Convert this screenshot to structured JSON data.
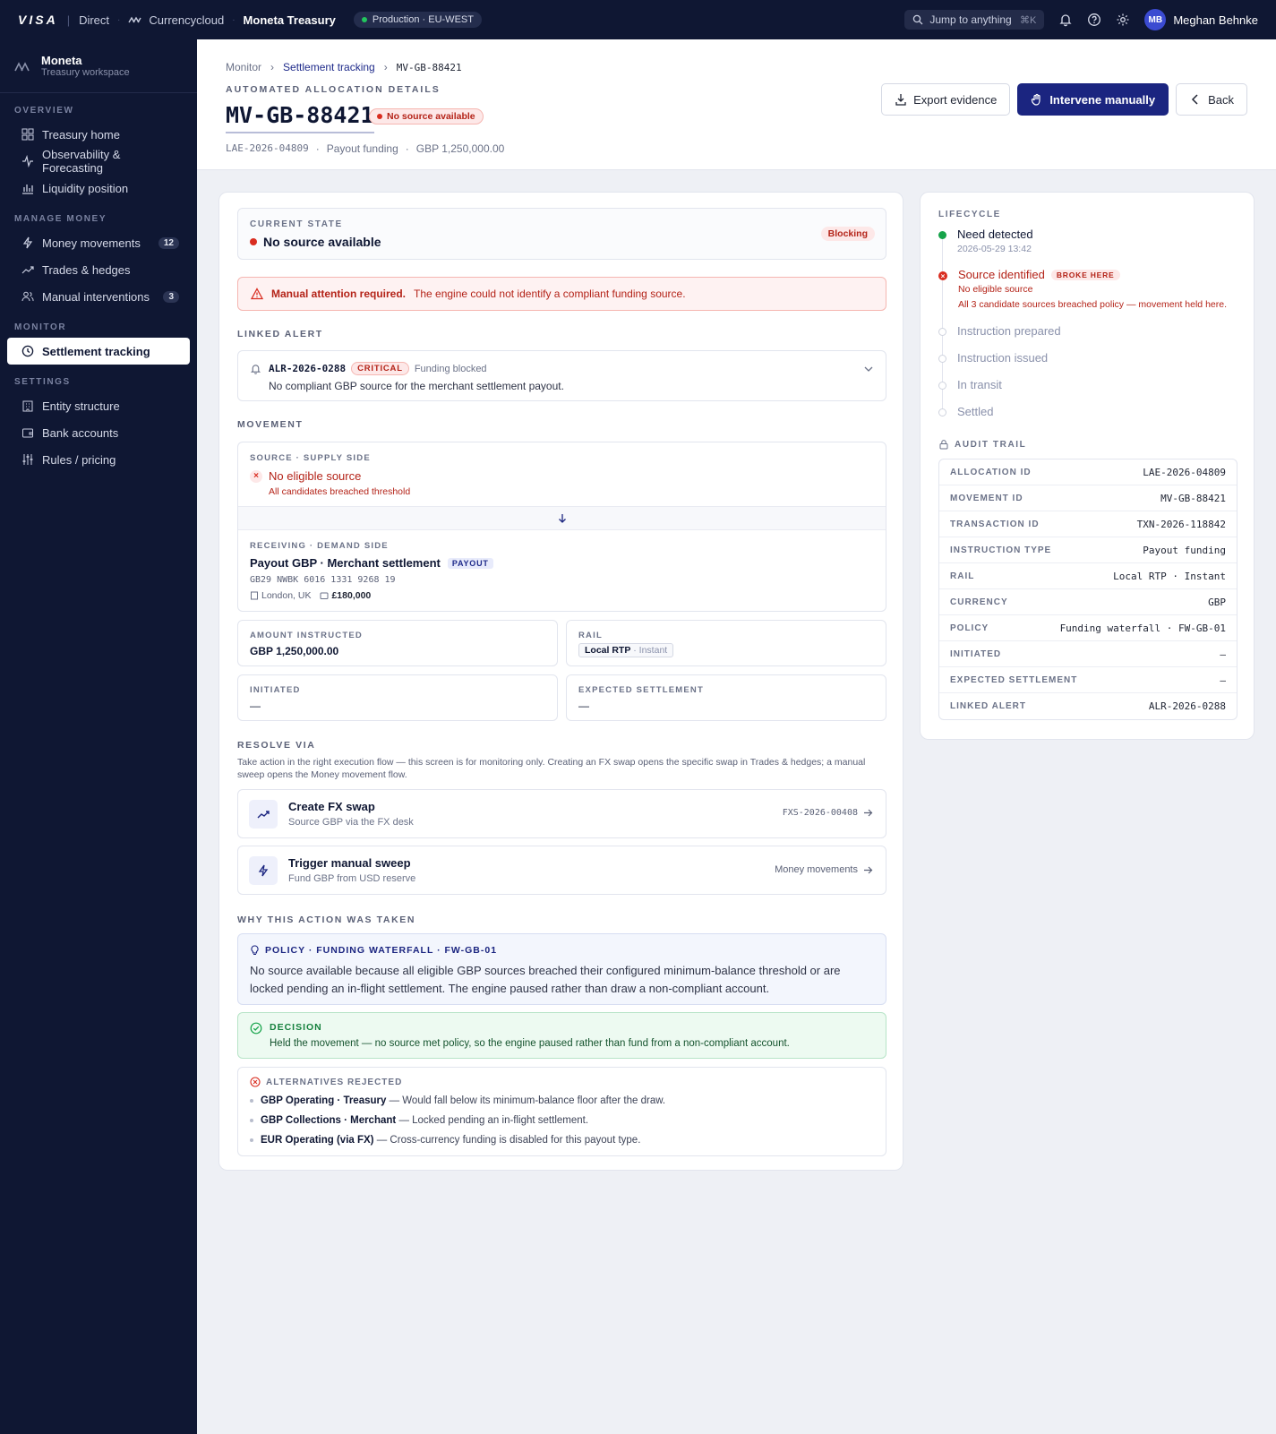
{
  "topbar": {
    "brand": "VISA",
    "product": "Direct",
    "partner": "Currencycloud",
    "workspace": "Moneta Treasury",
    "environment": "Production · EU-WEST",
    "search_placeholder": "Jump to anything",
    "search_shortcut": "⌘K",
    "user_initials": "MB",
    "user_name": "Meghan Behnke"
  },
  "sidebar": {
    "workspace_name": "Moneta",
    "workspace_sub": "Treasury workspace",
    "sections": {
      "overview": "OVERVIEW",
      "manage_money": "MANAGE MONEY",
      "monitor": "MONITOR",
      "settings": "SETTINGS"
    },
    "items": {
      "treasury_home": "Treasury home",
      "observability": "Observability & Forecasting",
      "liquidity": "Liquidity position",
      "money_movements": "Money movements",
      "money_movements_badge": "12",
      "trades": "Trades & hedges",
      "manual_interventions": "Manual interventions",
      "manual_interventions_badge": "3",
      "settlement_tracking": "Settlement tracking",
      "entity_structure": "Entity structure",
      "bank_accounts": "Bank accounts",
      "rules_pricing": "Rules / pricing"
    }
  },
  "header": {
    "breadcrumb": [
      "Monitor",
      "Settlement tracking",
      "MV-GB-88421"
    ],
    "eyebrow": "AUTOMATED ALLOCATION DETAILS",
    "title": "MV-GB-88421",
    "status_chip": "No source available",
    "meta": [
      "LAE-2026-04809",
      "·",
      "Payout funding",
      "·",
      "GBP 1,250,000.00"
    ],
    "actions": {
      "export": "Export evidence",
      "intervene": "Intervene manually",
      "back": "Back"
    }
  },
  "state": {
    "label": "CURRENT STATE",
    "value": "No source available",
    "badge": "Blocking"
  },
  "attention": {
    "strong": "Manual attention required.",
    "text": "The engine could not identify a compliant funding source."
  },
  "linked_alert": {
    "label": "LINKED ALERT",
    "id": "ALR-2026-0288",
    "severity": "CRITICAL",
    "type": "Funding blocked",
    "description": "No compliant GBP source for the merchant settlement payout."
  },
  "movement": {
    "label": "MOVEMENT",
    "source_label": "SOURCE · SUPPLY SIDE",
    "source_title": "No eligible source",
    "source_sub": "All candidates breached threshold",
    "receiving_label": "RECEIVING · DEMAND SIDE",
    "receiving_title": "Payout GBP · Merchant settlement",
    "receiving_chip": "PAYOUT",
    "iban": "GB29 NWBK 6016 1331 9268 19",
    "location": "London, UK",
    "balance": "£180,000"
  },
  "details": {
    "amount_label": "AMOUNT INSTRUCTED",
    "amount": "GBP 1,250,000.00",
    "rail_label": "RAIL",
    "rail": "Local RTP",
    "rail_speed": "· Instant",
    "initiated_label": "INITIATED",
    "initiated": "—",
    "expected_label": "EXPECTED SETTLEMENT",
    "expected": "—"
  },
  "resolve": {
    "label": "RESOLVE VIA",
    "description": "Take action in the right execution flow — this screen is for monitoring only. Creating an FX swap opens the specific swap in Trades & hedges; a manual sweep opens the Money movement flow.",
    "fx_title": "Create FX swap",
    "fx_sub": "Source GBP via the FX desk",
    "fx_link": "FXS-2026-00408",
    "sweep_title": "Trigger manual sweep",
    "sweep_sub": "Fund GBP from USD reserve",
    "sweep_link": "Money movements"
  },
  "why": {
    "label": "WHY THIS ACTION WAS TAKEN",
    "policy_label": "POLICY · FUNDING WATERFALL · FW-GB-01",
    "policy_text": "No source available because all eligible GBP sources breached their configured minimum-balance threshold or are locked pending an in-flight settlement. The engine paused rather than draw a non-compliant account.",
    "decision_label": "DECISION",
    "decision_text": "Held the movement — no source met policy, so the engine paused rather than fund from a non-compliant account.",
    "alts_label": "ALTERNATIVES REJECTED",
    "alternatives": [
      {
        "name": "GBP Operating · Treasury",
        "reason": "— Would fall below its minimum-balance floor after the draw."
      },
      {
        "name": "GBP Collections · Merchant",
        "reason": "— Locked pending an in-flight settlement."
      },
      {
        "name": "EUR Operating (via FX)",
        "reason": "— Cross-currency funding is disabled for this payout type."
      }
    ]
  },
  "lifecycle": {
    "label": "LIFECYCLE",
    "steps": [
      {
        "title": "Need detected",
        "sub": "2026-05-29 13:42",
        "state": "done"
      },
      {
        "title": "Source identified",
        "badge": "BROKE HERE",
        "sub": "No eligible source",
        "sub2": "All 3 candidate sources breached policy — movement held here.",
        "state": "error"
      },
      {
        "title": "Instruction prepared",
        "state": "pending"
      },
      {
        "title": "Instruction issued",
        "state": "pending"
      },
      {
        "title": "In transit",
        "state": "pending"
      },
      {
        "title": "Settled",
        "state": "pending"
      }
    ]
  },
  "audit": {
    "label": "AUDIT TRAIL",
    "rows": [
      {
        "k": "ALLOCATION ID",
        "v": "LAE-2026-04809"
      },
      {
        "k": "MOVEMENT ID",
        "v": "MV-GB-88421"
      },
      {
        "k": "TRANSACTION ID",
        "v": "TXN-2026-118842"
      },
      {
        "k": "INSTRUCTION TYPE",
        "v": "Payout funding"
      },
      {
        "k": "RAIL",
        "v": "Local RTP · Instant"
      },
      {
        "k": "CURRENCY",
        "v": "GBP"
      },
      {
        "k": "POLICY",
        "v": "Funding waterfall · FW-GB-01"
      },
      {
        "k": "INITIATED",
        "v": "—"
      },
      {
        "k": "EXPECTED SETTLEMENT",
        "v": "—"
      },
      {
        "k": "LINKED ALERT",
        "v": "ALR-2026-0288"
      }
    ]
  },
  "colors": {
    "nav_bg": "#0f1733",
    "primary": "#1b2580",
    "danger": "#d92d20",
    "success": "#16a34a"
  }
}
